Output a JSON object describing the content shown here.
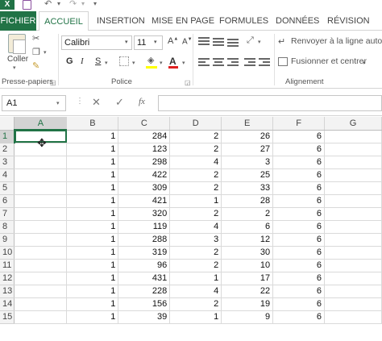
{
  "qat": {
    "app_logo": "X",
    "undo_glyph": "↶",
    "redo_glyph": "↷",
    "dropdown_glyph": "▾",
    "more_glyph": "▾"
  },
  "tabs": [
    {
      "label": "FICHIER"
    },
    {
      "label": "ACCUEIL"
    },
    {
      "label": "INSERTION"
    },
    {
      "label": "MISE EN PAGE"
    },
    {
      "label": "FORMULES"
    },
    {
      "label": "DONNÉES"
    },
    {
      "label": "RÉVISION"
    }
  ],
  "ribbon": {
    "clipboard": {
      "paste_label": "Coller",
      "group_label": "Presse-papiers"
    },
    "font": {
      "name": "Calibri",
      "size": "11",
      "bold": "G",
      "italic": "I",
      "underline": "S",
      "font_color_glyph": "A",
      "grow_glyph": "A",
      "shrink_glyph": "A",
      "group_label": "Police"
    },
    "alignment": {
      "wrap_label": "Renvoyer à la ligne automa",
      "merge_label": "Fusionner et centrer",
      "group_label": "Alignement"
    },
    "colors": {
      "fill": "#ffff00",
      "font": "#e02020",
      "accent": "#217346"
    }
  },
  "formula_bar": {
    "name_box": "A1",
    "cancel_glyph": "✕",
    "confirm_glyph": "✓",
    "fx_glyph": "fx",
    "formula": ""
  },
  "sheet": {
    "columns": [
      "A",
      "B",
      "C",
      "D",
      "E",
      "F",
      "G"
    ],
    "selected_column": "A",
    "selected_row": 1,
    "rows": [
      {
        "n": "1",
        "cells": [
          "",
          "1",
          "284",
          "2",
          "26",
          "6",
          ""
        ]
      },
      {
        "n": "2",
        "cells": [
          "",
          "1",
          "123",
          "2",
          "27",
          "6",
          ""
        ]
      },
      {
        "n": "3",
        "cells": [
          "",
          "1",
          "298",
          "4",
          "3",
          "6",
          ""
        ]
      },
      {
        "n": "4",
        "cells": [
          "",
          "1",
          "422",
          "2",
          "25",
          "6",
          ""
        ]
      },
      {
        "n": "5",
        "cells": [
          "",
          "1",
          "309",
          "2",
          "33",
          "6",
          ""
        ]
      },
      {
        "n": "6",
        "cells": [
          "",
          "1",
          "421",
          "1",
          "28",
          "6",
          ""
        ]
      },
      {
        "n": "7",
        "cells": [
          "",
          "1",
          "320",
          "2",
          "2",
          "6",
          ""
        ]
      },
      {
        "n": "8",
        "cells": [
          "",
          "1",
          "119",
          "4",
          "6",
          "6",
          ""
        ]
      },
      {
        "n": "9",
        "cells": [
          "",
          "1",
          "288",
          "3",
          "12",
          "6",
          ""
        ]
      },
      {
        "n": "10",
        "cells": [
          "",
          "1",
          "319",
          "2",
          "30",
          "6",
          ""
        ]
      },
      {
        "n": "11",
        "cells": [
          "",
          "1",
          "96",
          "2",
          "10",
          "6",
          ""
        ]
      },
      {
        "n": "12",
        "cells": [
          "",
          "1",
          "431",
          "1",
          "17",
          "6",
          ""
        ]
      },
      {
        "n": "13",
        "cells": [
          "",
          "1",
          "228",
          "4",
          "22",
          "6",
          ""
        ]
      },
      {
        "n": "14",
        "cells": [
          "",
          "1",
          "156",
          "2",
          "19",
          "6",
          ""
        ]
      },
      {
        "n": "15",
        "cells": [
          "",
          "1",
          "39",
          "1",
          "9",
          "6",
          ""
        ]
      }
    ]
  }
}
